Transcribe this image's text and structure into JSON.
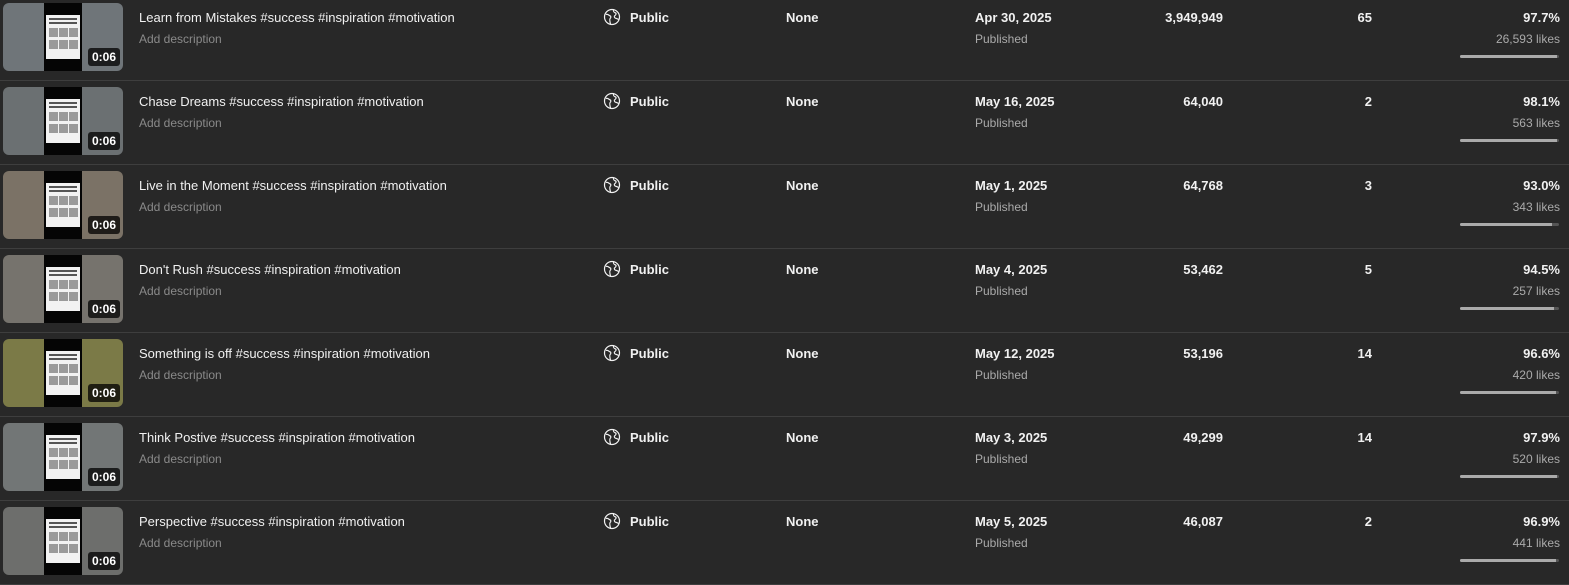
{
  "videos": [
    {
      "title": "Learn from Mistakes #success #inspiration #motivation",
      "description_placeholder": "Add description",
      "duration": "0:06",
      "visibility": "Public",
      "restrictions": "None",
      "date": "Apr 30, 2025",
      "status": "Published",
      "views": "3,949,949",
      "comments": "65",
      "like_percent": "97.7%",
      "likes": "26,593 likes",
      "like_fraction": 0.977,
      "thumb_color": "#6f7579"
    },
    {
      "title": "Chase Dreams #success #inspiration #motivation",
      "description_placeholder": "Add description",
      "duration": "0:06",
      "visibility": "Public",
      "restrictions": "None",
      "date": "May 16, 2025",
      "status": "Published",
      "views": "64,040",
      "comments": "2",
      "like_percent": "98.1%",
      "likes": "563 likes",
      "like_fraction": 0.981,
      "thumb_color": "#6b7072"
    },
    {
      "title": "Live in the Moment #success #inspiration #motivation",
      "description_placeholder": "Add description",
      "duration": "0:06",
      "visibility": "Public",
      "restrictions": "None",
      "date": "May 1, 2025",
      "status": "Published",
      "views": "64,768",
      "comments": "3",
      "like_percent": "93.0%",
      "likes": "343 likes",
      "like_fraction": 0.93,
      "thumb_color": "#7b7266"
    },
    {
      "title": "Don't Rush #success #inspiration #motivation",
      "description_placeholder": "Add description",
      "duration": "0:06",
      "visibility": "Public",
      "restrictions": "None",
      "date": "May 4, 2025",
      "status": "Published",
      "views": "53,462",
      "comments": "5",
      "like_percent": "94.5%",
      "likes": "257 likes",
      "like_fraction": 0.945,
      "thumb_color": "#76736d"
    },
    {
      "title": "Something is off #success #inspiration #motivation",
      "description_placeholder": "Add description",
      "duration": "0:06",
      "visibility": "Public",
      "restrictions": "None",
      "date": "May 12, 2025",
      "status": "Published",
      "views": "53,196",
      "comments": "14",
      "like_percent": "96.6%",
      "likes": "420 likes",
      "like_fraction": 0.966,
      "thumb_color": "#7b7a47"
    },
    {
      "title": "Think Postive #success #inspiration #motivation",
      "description_placeholder": "Add description",
      "duration": "0:06",
      "visibility": "Public",
      "restrictions": "None",
      "date": "May 3, 2025",
      "status": "Published",
      "views": "49,299",
      "comments": "14",
      "like_percent": "97.9%",
      "likes": "520 likes",
      "like_fraction": 0.979,
      "thumb_color": "#727676"
    },
    {
      "title": "Perspective #success #inspiration #motivation",
      "description_placeholder": "Add description",
      "duration": "0:06",
      "visibility": "Public",
      "restrictions": "None",
      "date": "May 5, 2025",
      "status": "Published",
      "views": "46,087",
      "comments": "2",
      "like_percent": "96.9%",
      "likes": "441 likes",
      "like_fraction": 0.969,
      "thumb_color": "#6d6e6c"
    }
  ],
  "icons": {
    "visibility": "globe-icon"
  }
}
